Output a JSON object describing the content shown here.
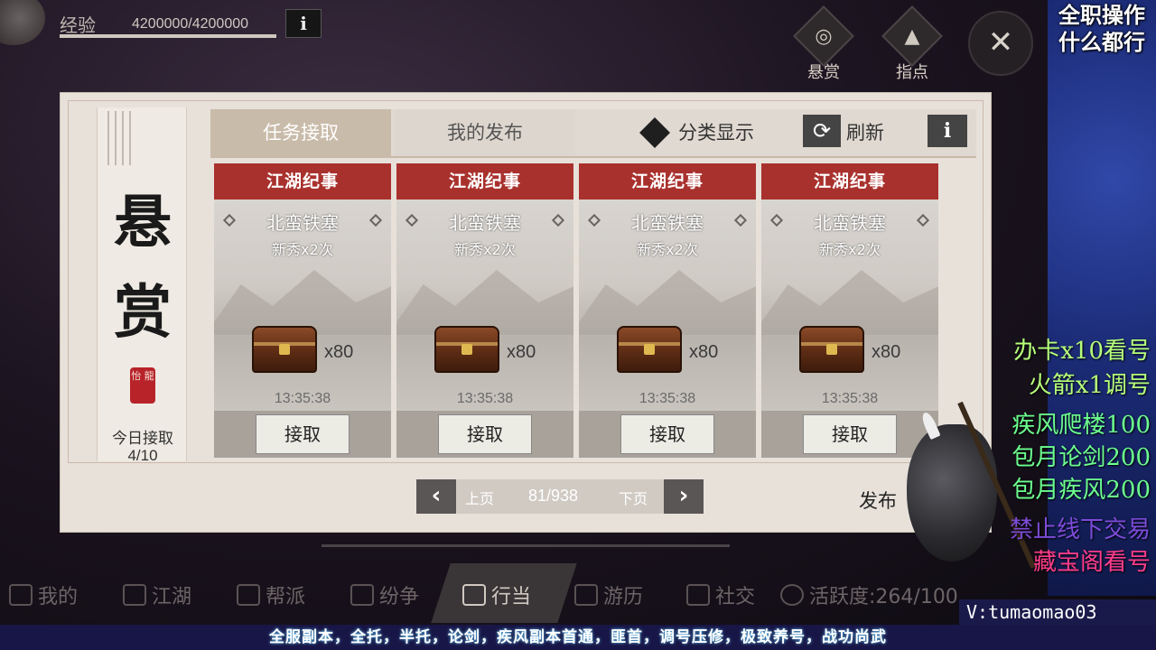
{
  "exp": {
    "label": "经验",
    "value": "4200000/4200000",
    "info": "i"
  },
  "top_buttons": {
    "bounty": "悬赏",
    "guide": "指点",
    "close": "✕"
  },
  "panel": {
    "side_title": "悬赏",
    "seal": "怡 龍",
    "today_label": "今日接取",
    "today_value": "4/10",
    "tabs": {
      "accept": "任务接取",
      "mine": "我的发布"
    },
    "category_label": "分类显示",
    "refresh_label": "刷新",
    "refresh_icon": "⟳",
    "info": "i",
    "cards": [
      {
        "category": "江湖纪事",
        "location": "北蛮铁塞",
        "requirement": "新秀x2次",
        "reward_count": "x80",
        "time": "13:35:38",
        "action": "接取"
      },
      {
        "category": "江湖纪事",
        "location": "北蛮铁塞",
        "requirement": "新秀x2次",
        "reward_count": "x80",
        "time": "13:35:38",
        "action": "接取"
      },
      {
        "category": "江湖纪事",
        "location": "北蛮铁塞",
        "requirement": "新秀x2次",
        "reward_count": "x80",
        "time": "13:35:38",
        "action": "接取"
      },
      {
        "category": "江湖纪事",
        "location": "北蛮铁塞",
        "requirement": "新秀x2次",
        "reward_count": "x80",
        "time": "13:35:38",
        "action": "接取"
      }
    ],
    "pager": {
      "prev_arrow": "‹",
      "prev_label": "上页",
      "page": "81/938",
      "next_label": "下页",
      "next_arrow": "›"
    },
    "publish_label": "发布"
  },
  "bottom_nav": {
    "items": [
      {
        "label": "我的",
        "icon": "user-icon"
      },
      {
        "label": "江湖",
        "icon": "scroll-icon"
      },
      {
        "label": "帮派",
        "icon": "banner-icon"
      },
      {
        "label": "纷争",
        "icon": "swords-icon"
      },
      {
        "label": "行当",
        "icon": "bag-icon"
      },
      {
        "label": "游历",
        "icon": "search-icon"
      },
      {
        "label": "社交",
        "icon": "people-icon"
      }
    ],
    "active": "行当",
    "activity_label": "活跃度:264/100"
  },
  "overlay": {
    "top_line1": "全职操作",
    "top_line2": "什么都行",
    "ad_lines": [
      "办卡x10看号",
      "火箭x1调号",
      "疾风爬楼100",
      "包月论剑200",
      "包月疾风200",
      "禁止线下交易",
      "藏宝阁看号"
    ],
    "ad_colors": [
      "#b6ff7a",
      "#b6ff7a",
      "#6cff8e",
      "#6cff8e",
      "#6cff8e",
      "#7d4bd8",
      "#ff3c8a"
    ],
    "vx": "V:tumaomao03",
    "bottom_banner": "全服副本，全托，半托，论剑，疾风副本首通，匪首，调号压修，极致养号，战功尚武"
  }
}
